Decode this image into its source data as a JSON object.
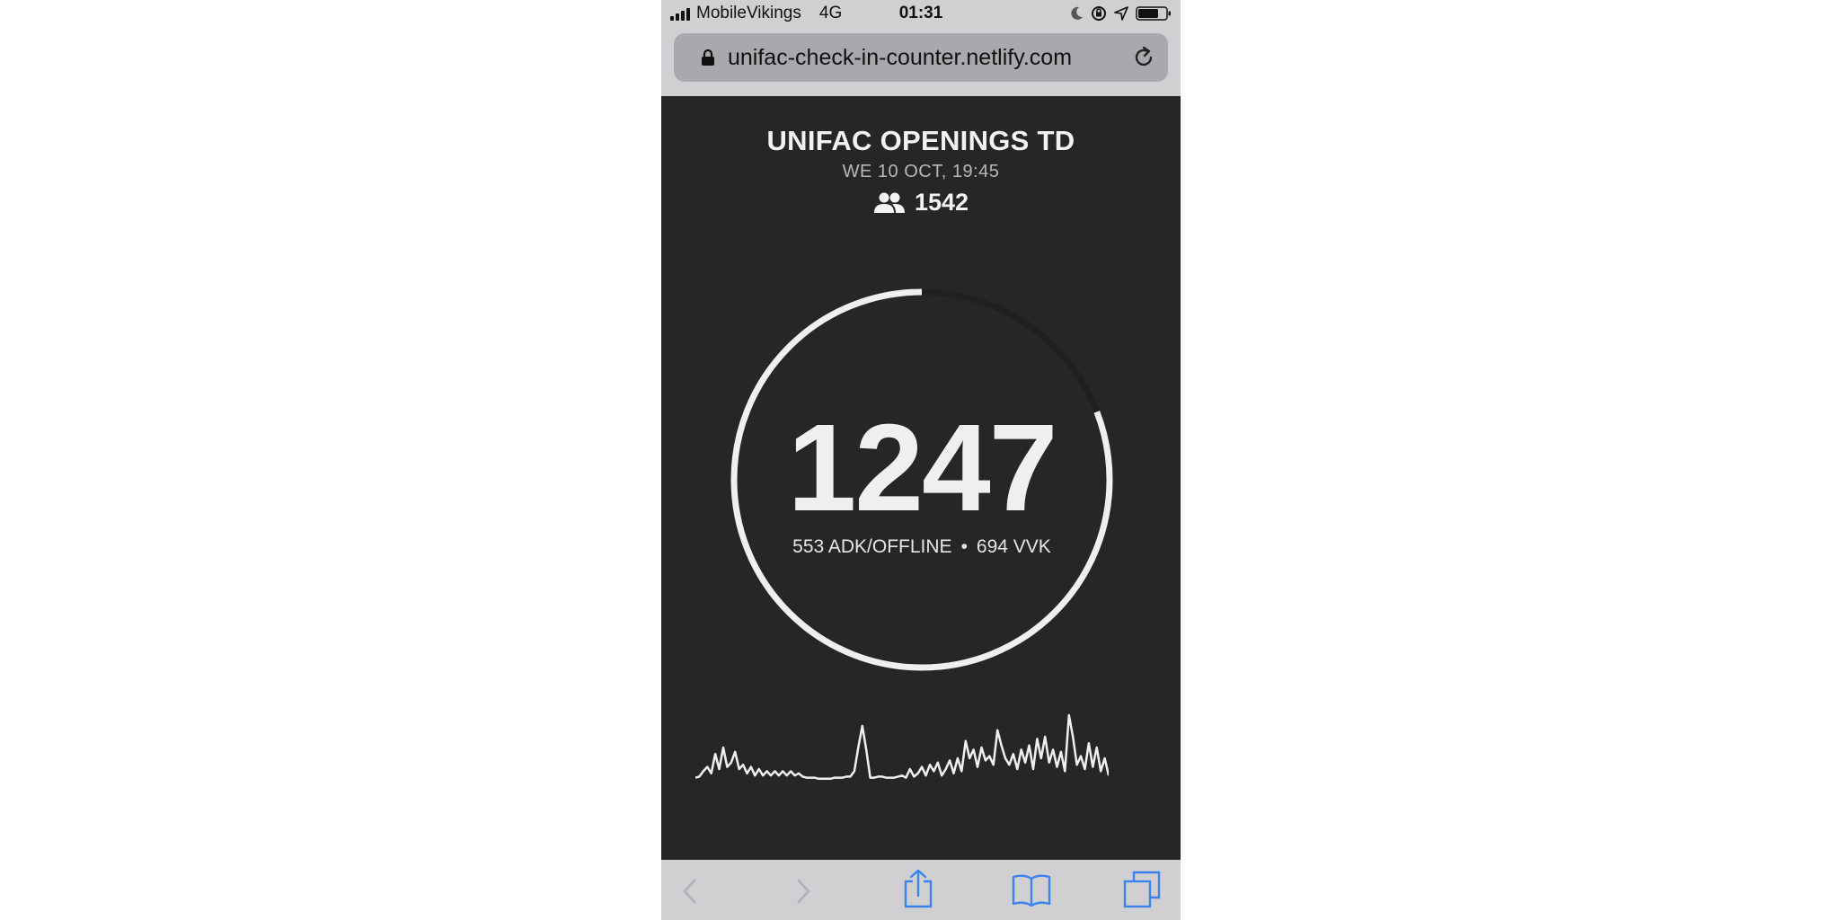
{
  "status_bar": {
    "carrier": "MobileVikings",
    "network": "4G",
    "time": "01:31",
    "icons": [
      "moon-icon",
      "orientation-lock-icon",
      "location-icon",
      "battery-icon"
    ]
  },
  "browser": {
    "url": "unifac-check-in-counter.netlify.com",
    "toolbar": [
      "back-icon",
      "forward-icon",
      "share-icon",
      "bookmarks-icon",
      "tabs-icon"
    ]
  },
  "event": {
    "title": "UNIFAC OPENINGS TD",
    "date": "WE 10 OCT, 19:45",
    "capacity": "1542"
  },
  "counter": {
    "total": "1247",
    "capacity_value": 1542,
    "checked_in_value": 1247,
    "adk_label": "553 ADK/OFFLINE",
    "separator": "•",
    "vvk_label": "694 VVK"
  },
  "colors": {
    "background": "#262626",
    "foreground": "#eef0f0",
    "ring_track": "#202020",
    "muted": "#b8b8b8"
  },
  "chart_data": {
    "type": "line",
    "series": [
      {
        "values": [
          2,
          3,
          8,
          12,
          6,
          24,
          10,
          30,
          12,
          16,
          26,
          10,
          14,
          6,
          12,
          4,
          10,
          4,
          8,
          4,
          8,
          4,
          8,
          4,
          8,
          4,
          6,
          3,
          2,
          2,
          2,
          1,
          1,
          1,
          1,
          2,
          2,
          2,
          3,
          3,
          8,
          30,
          50,
          28,
          2,
          2,
          3,
          3,
          2,
          2,
          2,
          3,
          4,
          2,
          10,
          3,
          6,
          12,
          4,
          14,
          8,
          16,
          4,
          10,
          18,
          6,
          20,
          8,
          36,
          20,
          28,
          12,
          30,
          18,
          22,
          14,
          46,
          32,
          20,
          14,
          24,
          10,
          28,
          16,
          32,
          10,
          38,
          20,
          40,
          16,
          28,
          12,
          26,
          8,
          60,
          40,
          14,
          22,
          10,
          34,
          12,
          30,
          8,
          20,
          4
        ]
      }
    ]
  }
}
